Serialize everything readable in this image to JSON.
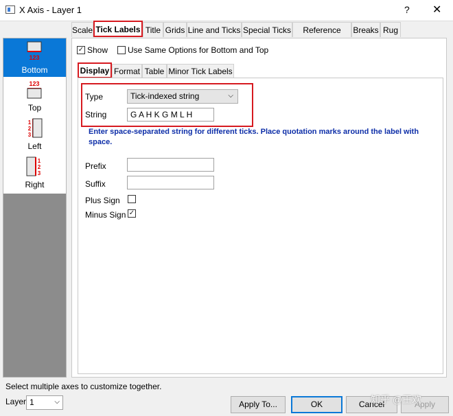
{
  "window": {
    "title": "X Axis - Layer 1",
    "help": "?",
    "close": "✕"
  },
  "top_tabs": [
    "Scale",
    "Tick Labels",
    "Title",
    "Grids",
    "Line and Ticks",
    "Special Ticks",
    "Reference Lines",
    "Breaks",
    "Rug"
  ],
  "active_top_tab": "Tick Labels",
  "sidebar": {
    "items": [
      {
        "label": "Bottom",
        "icon": "axis-bottom-icon",
        "selected": true
      },
      {
        "label": "Top",
        "icon": "axis-top-icon",
        "selected": false
      },
      {
        "label": "Left",
        "icon": "axis-left-icon",
        "selected": false
      },
      {
        "label": "Right",
        "icon": "axis-right-icon",
        "selected": false
      }
    ],
    "icon_digits": "123"
  },
  "options": {
    "show_label": "Show",
    "show_checked": true,
    "same_label": "Use Same Options for Bottom and Top",
    "same_checked": false
  },
  "sub_tabs": [
    "Display",
    "Format",
    "Table",
    "Minor Tick Labels"
  ],
  "active_sub_tab": "Display",
  "form": {
    "type_label": "Type",
    "type_value": "Tick-indexed string",
    "string_label": "String",
    "string_value": "G A H K G M L H",
    "hint": "Enter space-separated string for different ticks. Place quotation marks around the label with space.",
    "prefix_label": "Prefix",
    "prefix_value": "",
    "suffix_label": "Suffix",
    "suffix_value": "",
    "plus_label": "Plus Sign",
    "plus_checked": false,
    "minus_label": "Minus Sign",
    "minus_checked": true
  },
  "footer": {
    "note": "Select multiple axes to customize together.",
    "layer_label": "Layer",
    "layer_value": "1",
    "apply_to": "Apply To...",
    "ok": "OK",
    "cancel": "Cancel",
    "apply": "Apply"
  },
  "watermark": "知乎 @王欢",
  "colors": {
    "accent": "#0a78d7",
    "highlight": "#d6191f",
    "hint": "#0d2ea8"
  }
}
